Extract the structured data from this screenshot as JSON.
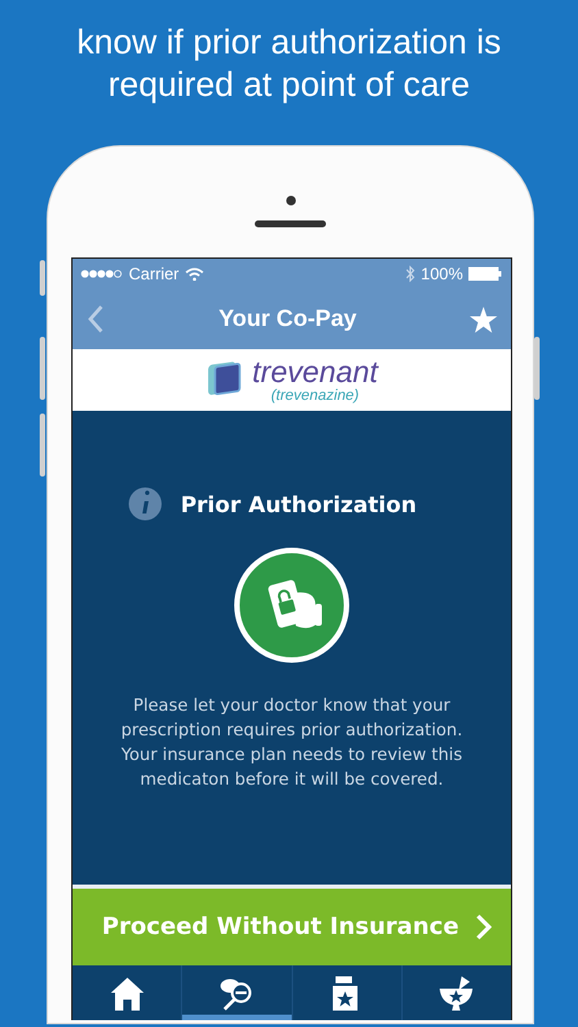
{
  "headline": "know if prior authorization is required at point of care",
  "status_bar": {
    "carrier": "Carrier",
    "battery": "100%"
  },
  "nav": {
    "title": "Your Co-Pay"
  },
  "brand": {
    "name": "trevenant",
    "generic": "(trevenazine)"
  },
  "notice": {
    "title": "Prior Authorization",
    "message": "Please let your doctor know that your prescription requires prior authorization. Your insurance plan needs to review this medicaton before it will be covered."
  },
  "action": {
    "label": "Proceed Without Insurance"
  },
  "tabs": [
    {
      "kind": "home",
      "selected": false
    },
    {
      "kind": "search",
      "selected": true
    },
    {
      "kind": "bottle",
      "selected": false
    },
    {
      "kind": "mortar",
      "selected": false
    }
  ]
}
